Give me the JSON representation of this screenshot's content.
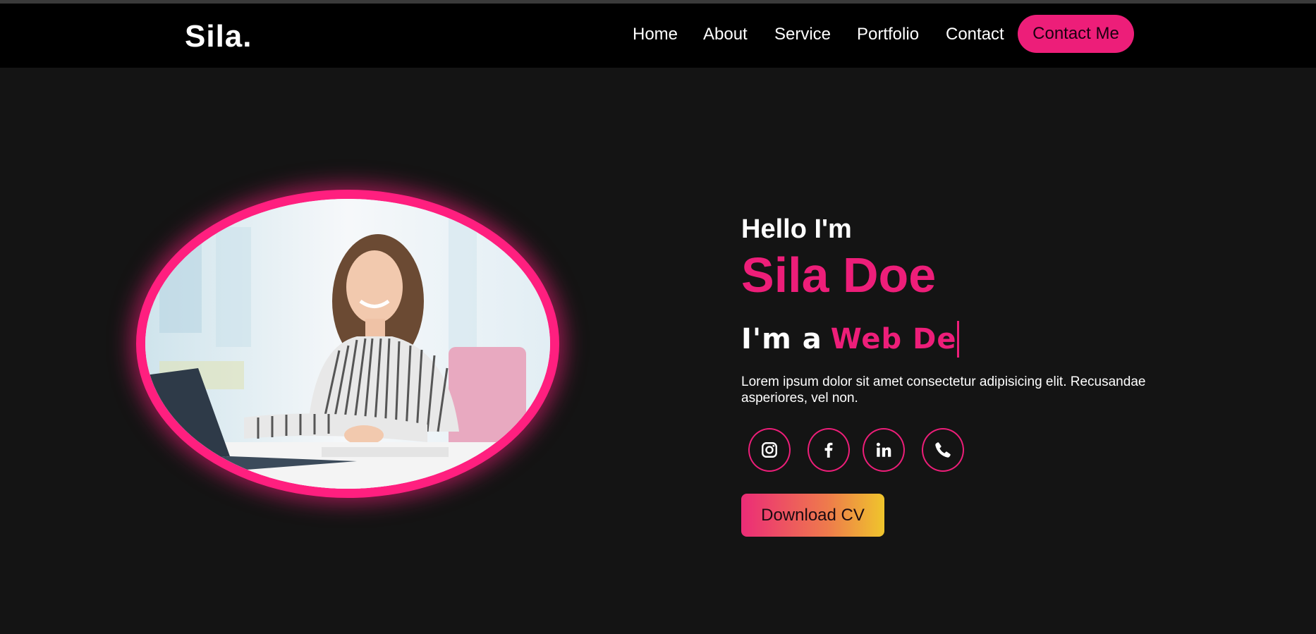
{
  "header": {
    "logo": "Sila.",
    "nav": [
      {
        "label": "Home"
      },
      {
        "label": "About"
      },
      {
        "label": "Service"
      },
      {
        "label": "Portfolio"
      },
      {
        "label": "Contact"
      }
    ],
    "cta_label": "Contact Me"
  },
  "hero": {
    "greeting": "Hello I'm",
    "name": "Sila Doe",
    "role_prefix": "I'm a",
    "role_typed": "Web De",
    "bio": "Lorem ipsum dolor sit amet consectetur adipisicing elit. Recusandae asperiores, vel non.",
    "socials": [
      {
        "icon": "instagram-icon"
      },
      {
        "icon": "facebook-icon"
      },
      {
        "icon": "linkedin-icon"
      },
      {
        "icon": "phone-icon"
      }
    ],
    "download_label": "Download CV",
    "photo_alt": "woman-at-laptop-photo"
  },
  "colors": {
    "accent": "#ed1e79",
    "background": "#141414",
    "navbar": "#000000",
    "cv_gradient": [
      "#ec2c77",
      "#ee7a4c",
      "#efc52c"
    ]
  }
}
